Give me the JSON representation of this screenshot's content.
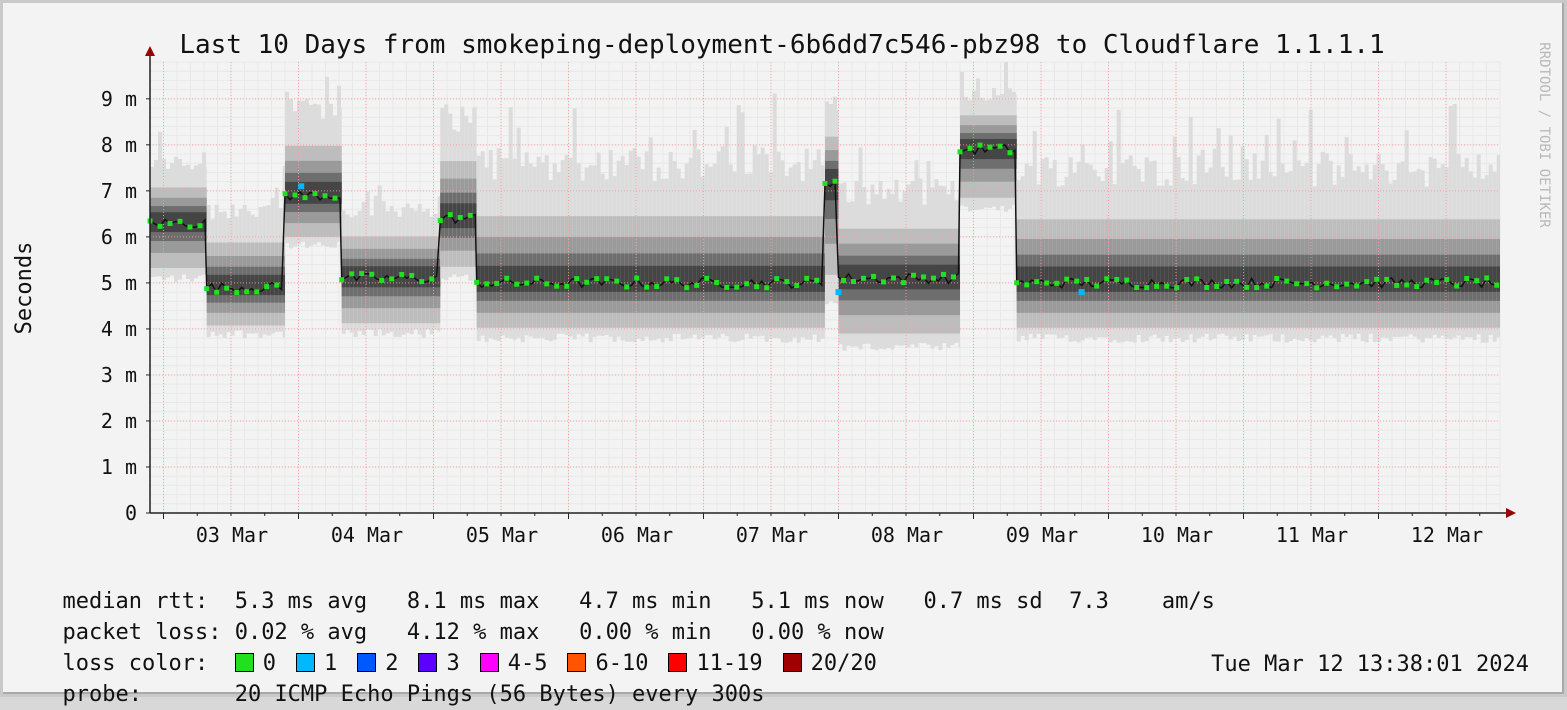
{
  "chart_data": {
    "type": "line",
    "title": "Last 10 Days from smokeping-deployment-6b6dd7c546-pbz98 to Cloudflare 1.1.1.1",
    "ylabel": "Seconds",
    "xlabel": "",
    "watermark": "RRDTOOL / TOBI OETIKER",
    "ylim": [
      0,
      0.0098
    ],
    "xlim": [
      0,
      10.0
    ],
    "grid": true,
    "y_ticks": [
      {
        "value": 0,
        "label": "0"
      },
      {
        "value": 0.001,
        "label": "1 m"
      },
      {
        "value": 0.002,
        "label": "2 m"
      },
      {
        "value": 0.003,
        "label": "3 m"
      },
      {
        "value": 0.004,
        "label": "4 m"
      },
      {
        "value": 0.005,
        "label": "5 m"
      },
      {
        "value": 0.006,
        "label": "6 m"
      },
      {
        "value": 0.007,
        "label": "7 m"
      },
      {
        "value": 0.008,
        "label": "8 m"
      },
      {
        "value": 0.009,
        "label": "9 m"
      }
    ],
    "x_ticks": [
      {
        "value": 0.6,
        "label": "03 Mar"
      },
      {
        "value": 1.6,
        "label": "04 Mar"
      },
      {
        "value": 2.6,
        "label": "05 Mar"
      },
      {
        "value": 3.6,
        "label": "06 Mar"
      },
      {
        "value": 4.6,
        "label": "07 Mar"
      },
      {
        "value": 5.6,
        "label": "08 Mar"
      },
      {
        "value": 6.6,
        "label": "09 Mar"
      },
      {
        "value": 7.6,
        "label": "10 Mar"
      },
      {
        "value": 8.6,
        "label": "11 Mar"
      },
      {
        "value": 9.6,
        "label": "12 Mar"
      }
    ],
    "series": [
      {
        "name": "median rtt",
        "color": "#20e020",
        "segments": [
          {
            "x0": 0.0,
            "x1": 0.42,
            "median": 0.0063,
            "low": 0.005,
            "high": 0.0083
          },
          {
            "x0": 0.42,
            "x1": 1.0,
            "median": 0.0049,
            "low": 0.0038,
            "high": 0.0075
          },
          {
            "x0": 1.0,
            "x1": 1.42,
            "median": 0.0069,
            "low": 0.0057,
            "high": 0.0098
          },
          {
            "x0": 1.42,
            "x1": 2.15,
            "median": 0.0051,
            "low": 0.0038,
            "high": 0.0075
          },
          {
            "x0": 2.15,
            "x1": 2.42,
            "median": 0.0064,
            "low": 0.005,
            "high": 0.0098
          },
          {
            "x0": 2.42,
            "x1": 5.0,
            "median": 0.005,
            "low": 0.0037,
            "high": 0.009
          },
          {
            "x0": 5.0,
            "x1": 5.1,
            "median": 0.0072,
            "low": 0.0045,
            "high": 0.0098
          },
          {
            "x0": 5.1,
            "x1": 6.0,
            "median": 0.0051,
            "low": 0.0035,
            "high": 0.008
          },
          {
            "x0": 6.0,
            "x1": 6.42,
            "median": 0.0079,
            "low": 0.0065,
            "high": 0.0098
          },
          {
            "x0": 6.42,
            "x1": 10.0,
            "median": 0.005,
            "low": 0.0037,
            "high": 0.0088
          }
        ]
      }
    ],
    "loss_points": [
      {
        "x": 1.12,
        "y": 0.0071,
        "loss": "1"
      },
      {
        "x": 5.1,
        "y": 0.0048,
        "loss": "1"
      },
      {
        "x": 6.9,
        "y": 0.0048,
        "loss": "1"
      }
    ]
  },
  "legend": {
    "median_rtt": {
      "label": "median rtt:",
      "text": "5.3 ms avg   8.1 ms max   4.7 ms min   5.1 ms now   0.7 ms sd  7.3    am/s"
    },
    "packet_loss": {
      "label": "packet loss:",
      "text": "0.02 % avg   4.12 % max   0.00 % min   0.00 % now"
    },
    "loss_color": {
      "label": "loss color:",
      "items": [
        {
          "label": "0",
          "color": "#20e020"
        },
        {
          "label": "1",
          "color": "#00b8ff"
        },
        {
          "label": "2",
          "color": "#0059ff"
        },
        {
          "label": "3",
          "color": "#5e00ff"
        },
        {
          "label": "4-5",
          "color": "#ff00ff"
        },
        {
          "label": "6-10",
          "color": "#ff5500"
        },
        {
          "label": "11-19",
          "color": "#ff0000"
        },
        {
          "label": "20/20",
          "color": "#a10000"
        }
      ]
    },
    "probe": {
      "label": "probe:",
      "text": "20 ICMP Echo Pings (56 Bytes) every 300s",
      "timestamp": "Tue Mar 12 13:38:01 2024"
    }
  }
}
